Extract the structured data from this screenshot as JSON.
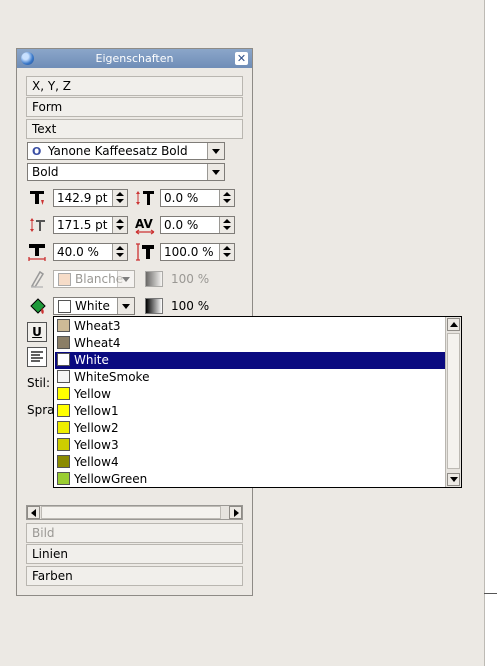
{
  "window": {
    "title": "Eigenschaften"
  },
  "sections_top": [
    {
      "label": "X, Y, Z"
    },
    {
      "label": "Form"
    },
    {
      "label": "Text"
    }
  ],
  "font": {
    "family": "Yanone Kaffeesatz Bold",
    "style": "Bold"
  },
  "metrics": {
    "font_size": "142.9 pt",
    "line_spacing_pct": "0.0 %",
    "line_spacing": "171.5 pt",
    "tracking": "0.0 %",
    "scale_width": "40.0 %",
    "scale_height": "100.0 %"
  },
  "stroke_color": {
    "value": "Blanche",
    "shade": "100 %"
  },
  "fill_color": {
    "value": "White",
    "shade": "100 %"
  },
  "labels": {
    "style": "Stil:",
    "language": "Spra"
  },
  "color_list": [
    {
      "name": "Wheat3",
      "color": "#cdba96"
    },
    {
      "name": "Wheat4",
      "color": "#8b7e66"
    },
    {
      "name": "White",
      "color": "#ffffff",
      "selected": true
    },
    {
      "name": "WhiteSmoke",
      "color": "#f5f5f5"
    },
    {
      "name": "Yellow",
      "color": "#ffff00"
    },
    {
      "name": "Yellow1",
      "color": "#ffff00"
    },
    {
      "name": "Yellow2",
      "color": "#eeee00"
    },
    {
      "name": "Yellow3",
      "color": "#cdcd00"
    },
    {
      "name": "Yellow4",
      "color": "#8b8b00"
    },
    {
      "name": "YellowGreen",
      "color": "#9acd32"
    }
  ],
  "sections_bottom": [
    {
      "label": "Bild",
      "disabled": true
    },
    {
      "label": "Linien"
    },
    {
      "label": "Farben"
    }
  ],
  "colors": {
    "title_bar": "#7b97c0",
    "selection": "#0a0a80"
  }
}
